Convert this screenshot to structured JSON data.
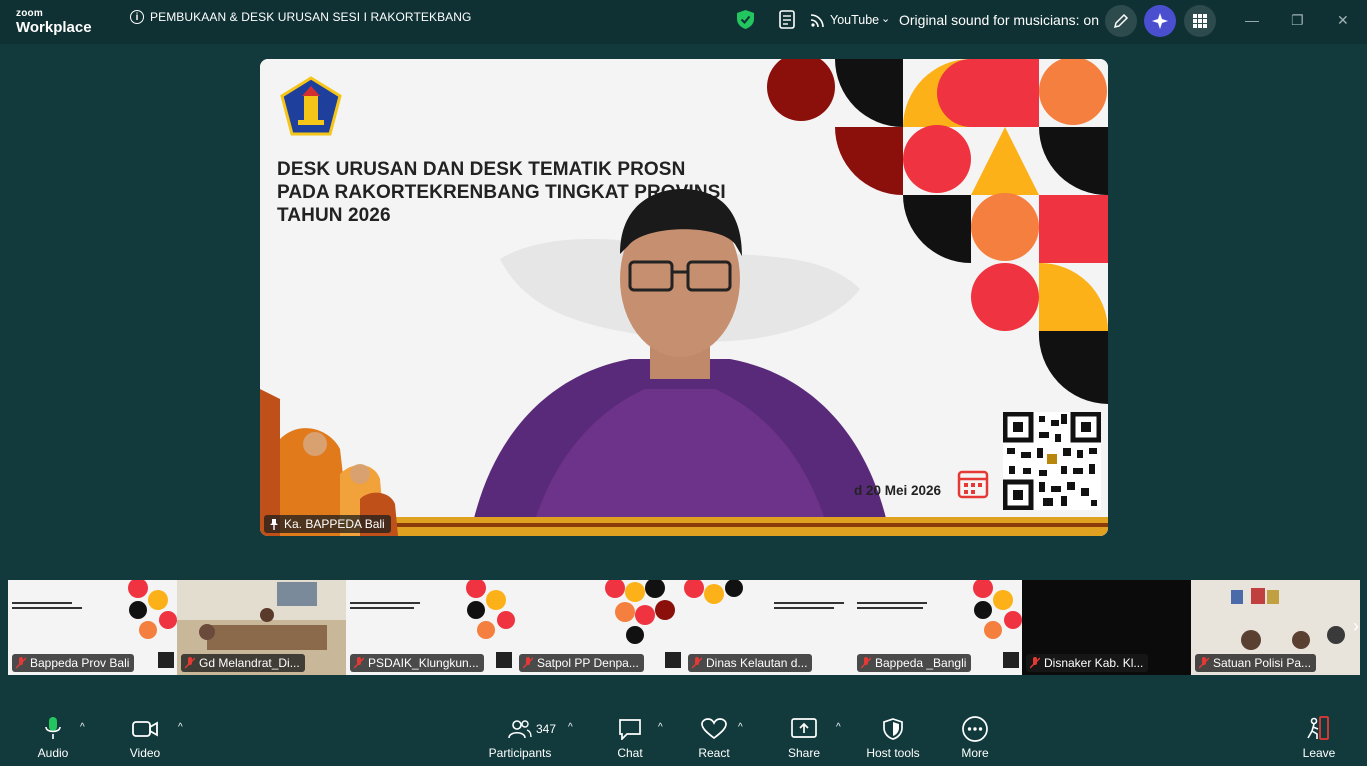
{
  "app": {
    "brand_top": "zoom",
    "brand_bottom": "Workplace",
    "meeting_title": "PEMBUKAAN & DESK URUSAN SESI I RAKORTEKBANG",
    "info_glyph": "i"
  },
  "titlebar": {
    "youtube_label": "YouTube",
    "youtube_caret": "⌄",
    "sound_label": "Original sound for musicians: on",
    "minimize": "—",
    "restore": "❐",
    "close": "✕"
  },
  "slide": {
    "title_lines": [
      "DESK URUSAN DAN DESK TEMATIK PROSN",
      "PADA RAKORTEKRENBANG TINGKAT PROVINSI",
      "TAHUN 2026"
    ],
    "date_text": "d 20 Mei 2026",
    "speaker_name": "Ka. BAPPEDA Bali",
    "colors": {
      "red": "#ef3340",
      "dark_red": "#8b0f0a",
      "orange": "#f47f3f",
      "yellow": "#fbb117",
      "black": "#111111"
    }
  },
  "participants_strip": [
    {
      "name": "Bappeda Prov Bali",
      "type": "slide"
    },
    {
      "name": "Gd Melandrat_Di...",
      "type": "room"
    },
    {
      "name": "PSDAIK_Klungkun...",
      "type": "slide"
    },
    {
      "name": "Satpol PP Denpa...",
      "type": "slide"
    },
    {
      "name": "Dinas Kelautan d...",
      "type": "slide"
    },
    {
      "name": "Bappeda _Bangli",
      "type": "slide"
    },
    {
      "name": "Disnaker Kab. Kl...",
      "type": "dark"
    },
    {
      "name": "Satuan Polisi Pa...",
      "type": "room"
    }
  ],
  "toolbar": {
    "audio": "Audio",
    "video": "Video",
    "participants": "Participants",
    "participants_count": "347",
    "chat": "Chat",
    "react": "React",
    "share": "Share",
    "host_tools": "Host tools",
    "more": "More",
    "leave": "Leave",
    "caret": "^"
  }
}
